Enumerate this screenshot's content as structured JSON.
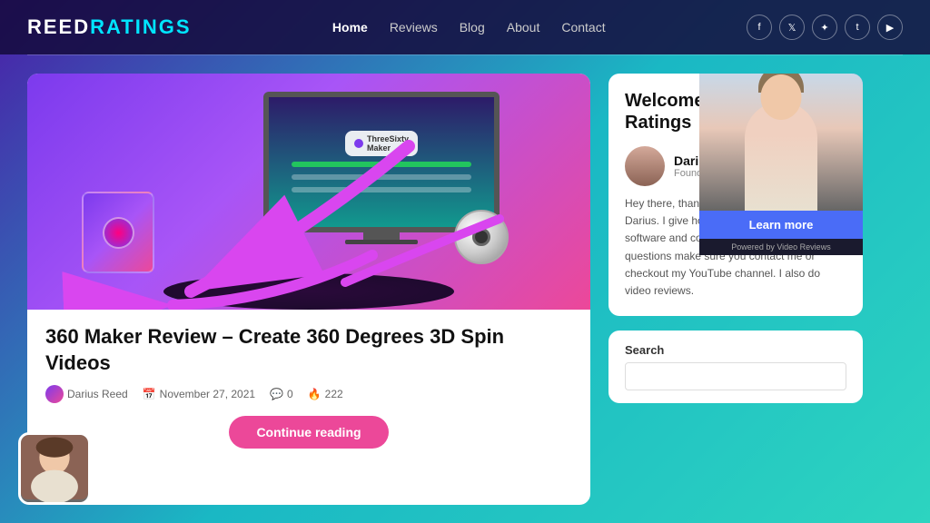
{
  "header": {
    "logo_text": "ReedRatings",
    "nav_items": [
      {
        "label": "Home",
        "active": true
      },
      {
        "label": "Reviews",
        "active": false
      },
      {
        "label": "Blog",
        "active": false
      },
      {
        "label": "About",
        "active": false
      },
      {
        "label": "Contact",
        "active": false
      }
    ],
    "social": [
      "f",
      "t",
      "p",
      "t",
      "yt"
    ]
  },
  "article": {
    "title": "360 Maker Review – Create 360 Degrees 3D Spin Videos",
    "author": "Darius Reed",
    "date": "November 27, 2021",
    "comments": "0",
    "views": "222",
    "continue_btn": "Continue reading"
  },
  "sidebar": {
    "welcome_title": "Welcome to Reed Ratings",
    "author_name": "Darius",
    "author_role": "Founder",
    "bio_text": "Hey there, thanks for visiting. My name is Darius. I give honest reviews about the latest software and courses. If you have any questions make sure you contact me or checkout my YouTube channel. I also do video reviews.",
    "search_label": "Search",
    "search_placeholder": "",
    "learn_more_btn": "Learn more",
    "powered_by": "Powered by Video Reviews"
  }
}
